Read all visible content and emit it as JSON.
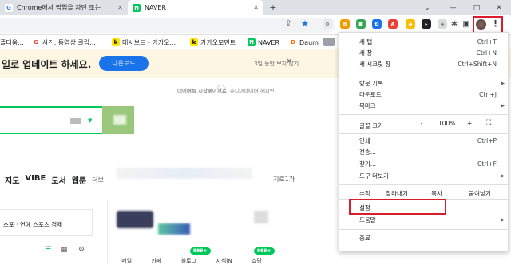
{
  "tabs": [
    {
      "title": "Chrome에서 팝업을 차단 또는",
      "icon": "google-icon"
    },
    {
      "title": "NAVER",
      "icon": "naver-icon"
    }
  ],
  "window": {
    "new_tab": "+",
    "minimize": "⌄",
    "maximize": "□",
    "close": "✕"
  },
  "bookmarks": [
    {
      "label": "폴더움..."
    },
    {
      "label": "사진, 동영상 클립..."
    },
    {
      "label": "대시보드 - 카카오..."
    },
    {
      "label": "카카오모먼트"
    },
    {
      "label": "NAVER"
    },
    {
      "label": "Daum"
    }
  ],
  "banner": {
    "text": "일로 업데이트 하세요.",
    "button": "다운로드",
    "dismiss": "3일 동안 보지 않기",
    "close": "✕"
  },
  "naver": {
    "start_page": "네이버를 시작페이지로",
    "links": "쥬니어네이버   해피빈",
    "nav": [
      "지도",
      "VIBE",
      "도서",
      "웹툰"
    ],
    "nav_more": "더보",
    "right_text": "지로1가",
    "news_tabs": "스포 · 연예  스포츠  경제",
    "badges": [
      "999+",
      "999+"
    ],
    "bottom_tabs": [
      "메일",
      "카페",
      "블로그",
      "지식iN",
      "쇼핑"
    ]
  },
  "menu": {
    "items": [
      {
        "label": "새 탭",
        "shortcut": "Ctrl+T"
      },
      {
        "label": "새 창",
        "shortcut": "Ctrl+N"
      },
      {
        "label": "새 시크릿 창",
        "shortcut": "Ctrl+Shift+N"
      },
      {
        "label": "방문 기록",
        "arrow": "▶"
      },
      {
        "label": "다운로드",
        "shortcut": "Ctrl+J"
      },
      {
        "label": "북마크",
        "arrow": "▶"
      }
    ],
    "zoom": {
      "label": "글꼴 크기",
      "minus": "-",
      "value": "100%",
      "plus": "+",
      "fullscreen": "⛶"
    },
    "items2": [
      {
        "label": "인쇄",
        "shortcut": "Ctrl+P"
      },
      {
        "label": "전송...",
        "shortcut": ""
      },
      {
        "label": "찾기...",
        "shortcut": "Ctrl+F"
      },
      {
        "label": "도구 더보기",
        "arrow": "▶"
      }
    ],
    "edit": {
      "label": "수정",
      "cut": "잘라내기",
      "copy": "복사",
      "paste": "붙여넣기"
    },
    "settings": "설정",
    "help": "도움말",
    "help_arrow": "▶",
    "exit": "종료"
  },
  "colors": {
    "highlight": "#d91d2c",
    "naver_green": "#03c75a",
    "download_blue": "#1a73e8"
  }
}
